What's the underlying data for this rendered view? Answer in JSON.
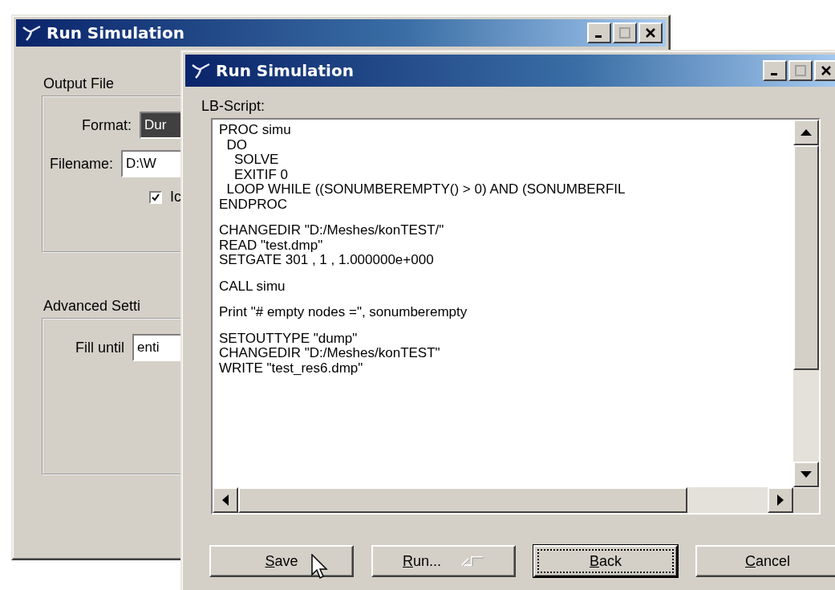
{
  "back_window": {
    "title": "Run Simulation",
    "output_file": {
      "heading": "Output File",
      "format_label": "Format:",
      "format_value": "Dur",
      "filename_label": "Filename:",
      "filename_value": "D:\\W",
      "checkbox": {
        "label": "Ic",
        "checked": true
      }
    },
    "advanced": {
      "heading": "Advanced Setti",
      "fill_label": "Fill until",
      "fill_value": "enti"
    }
  },
  "front_window": {
    "title": "Run Simulation",
    "script_label": "LB-Script:",
    "script_blocks": [
      {
        "lines": [
          "PROC simu",
          "  DO",
          "    SOLVE",
          "    EXITIF 0",
          "  LOOP WHILE ((SONUMBEREMPTY() > 0) AND (SONUMBERFIL",
          "ENDPROC"
        ]
      },
      {
        "lines": [
          "CHANGEDIR \"D:/Meshes/konTEST/\"",
          "READ \"test.dmp\"",
          "SETGATE 301 , 1 , 1.000000e+000"
        ]
      },
      {
        "lines": [
          "CALL simu"
        ]
      },
      {
        "lines": [
          "Print \"# empty nodes =\", sonumberempty"
        ]
      },
      {
        "lines": [
          "SETOUTTYPE \"dump\"",
          "CHANGEDIR \"D:/Meshes/konTEST\"",
          "WRITE \"test_res6.dmp\""
        ]
      }
    ],
    "buttons": [
      {
        "key": "S",
        "rest": "ave",
        "kind": "plain",
        "focused": false
      },
      {
        "key": "R",
        "rest": "un...",
        "kind": "enter",
        "focused": false
      },
      {
        "key": "B",
        "rest": "ack",
        "kind": "plain",
        "focused": true
      },
      {
        "key": "C",
        "rest": "ancel",
        "kind": "plain",
        "focused": false
      }
    ]
  }
}
